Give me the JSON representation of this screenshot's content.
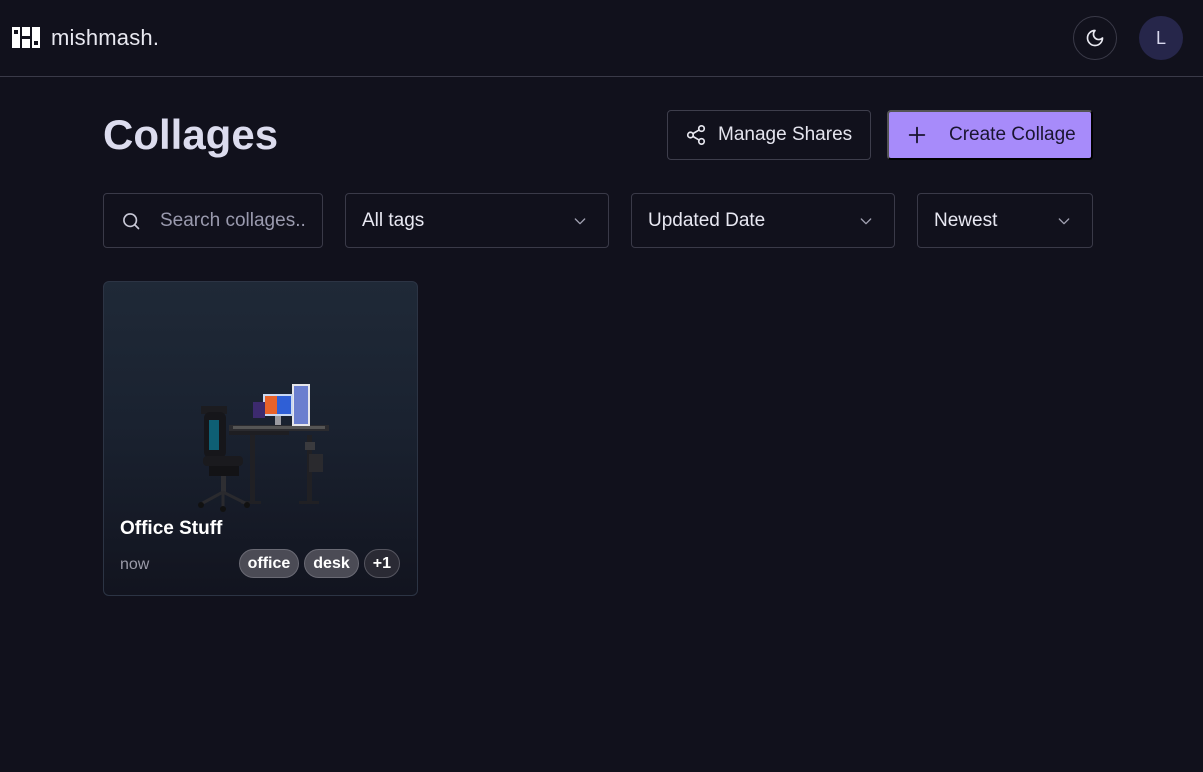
{
  "app": {
    "name": "mishmash."
  },
  "header": {
    "avatar_initial": "L",
    "theme_icon": "moon-icon"
  },
  "page": {
    "title": "Collages"
  },
  "toolbar": {
    "manage_shares_label": "Manage Shares",
    "create_collage_label": "Create Collage"
  },
  "filters": {
    "search_placeholder": "Search collages..",
    "tags_value": "All tags",
    "sort_field_value": "Updated Date",
    "sort_order_value": "Newest"
  },
  "collages": [
    {
      "title": "Office Stuff",
      "updated": "now",
      "tags": [
        "office",
        "desk"
      ],
      "more_tags": "+1"
    }
  ],
  "colors": {
    "background": "#11111c",
    "accent": "#a78bfa",
    "border": "#3a3a48"
  }
}
